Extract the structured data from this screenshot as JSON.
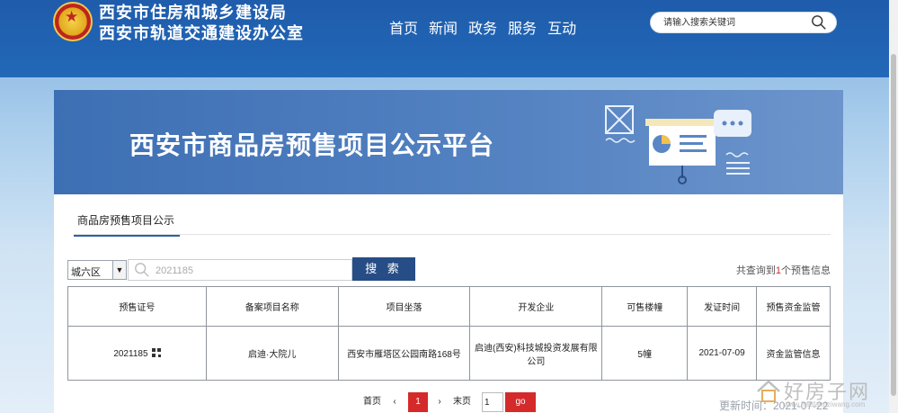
{
  "header": {
    "org_line1": "西安市住房和城乡建设局",
    "org_line2": "西安市轨道交通建设办公室",
    "nav": [
      "首页",
      "新闻",
      "政务",
      "服务",
      "互动"
    ],
    "search_placeholder": "请输入搜索关键词"
  },
  "banner": {
    "title": "西安市商品房预售项目公示平台"
  },
  "tabs": [
    "商品房预售项目公示"
  ],
  "filter": {
    "district": "城六区",
    "search_value": "2021185",
    "search_button": "搜 索",
    "result_prefix": "共查询到",
    "result_count": "1",
    "result_suffix": "个预售信息"
  },
  "table": {
    "headers": [
      "预售证号",
      "备案项目名称",
      "项目坐落",
      "开发企业",
      "可售楼幢",
      "发证时间",
      "预售资金监管"
    ],
    "rows": [
      {
        "cert_no": "2021185",
        "project": "启迪·大院儿",
        "location": "西安市雁塔区公园南路168号",
        "developer": "启迪(西安)科技城投资发展有限公司",
        "buildings": "5幢",
        "issue_date": "2021-07-09",
        "fund": "资金监管信息"
      }
    ]
  },
  "pager": {
    "first": "首页",
    "prev": "‹",
    "current": "1",
    "next": "›",
    "last": "末页",
    "page_input": "1",
    "go": "go"
  },
  "footer": {
    "update_text": "更新时间：2021-07-22"
  },
  "watermark": {
    "text": "好房子网",
    "url": "www.haofangziwang.com"
  },
  "colors": {
    "header_blue": "#1f5cab",
    "banner_blue": "#4674b8",
    "search_button": "#274d86",
    "accent_red": "#d42a2a"
  }
}
